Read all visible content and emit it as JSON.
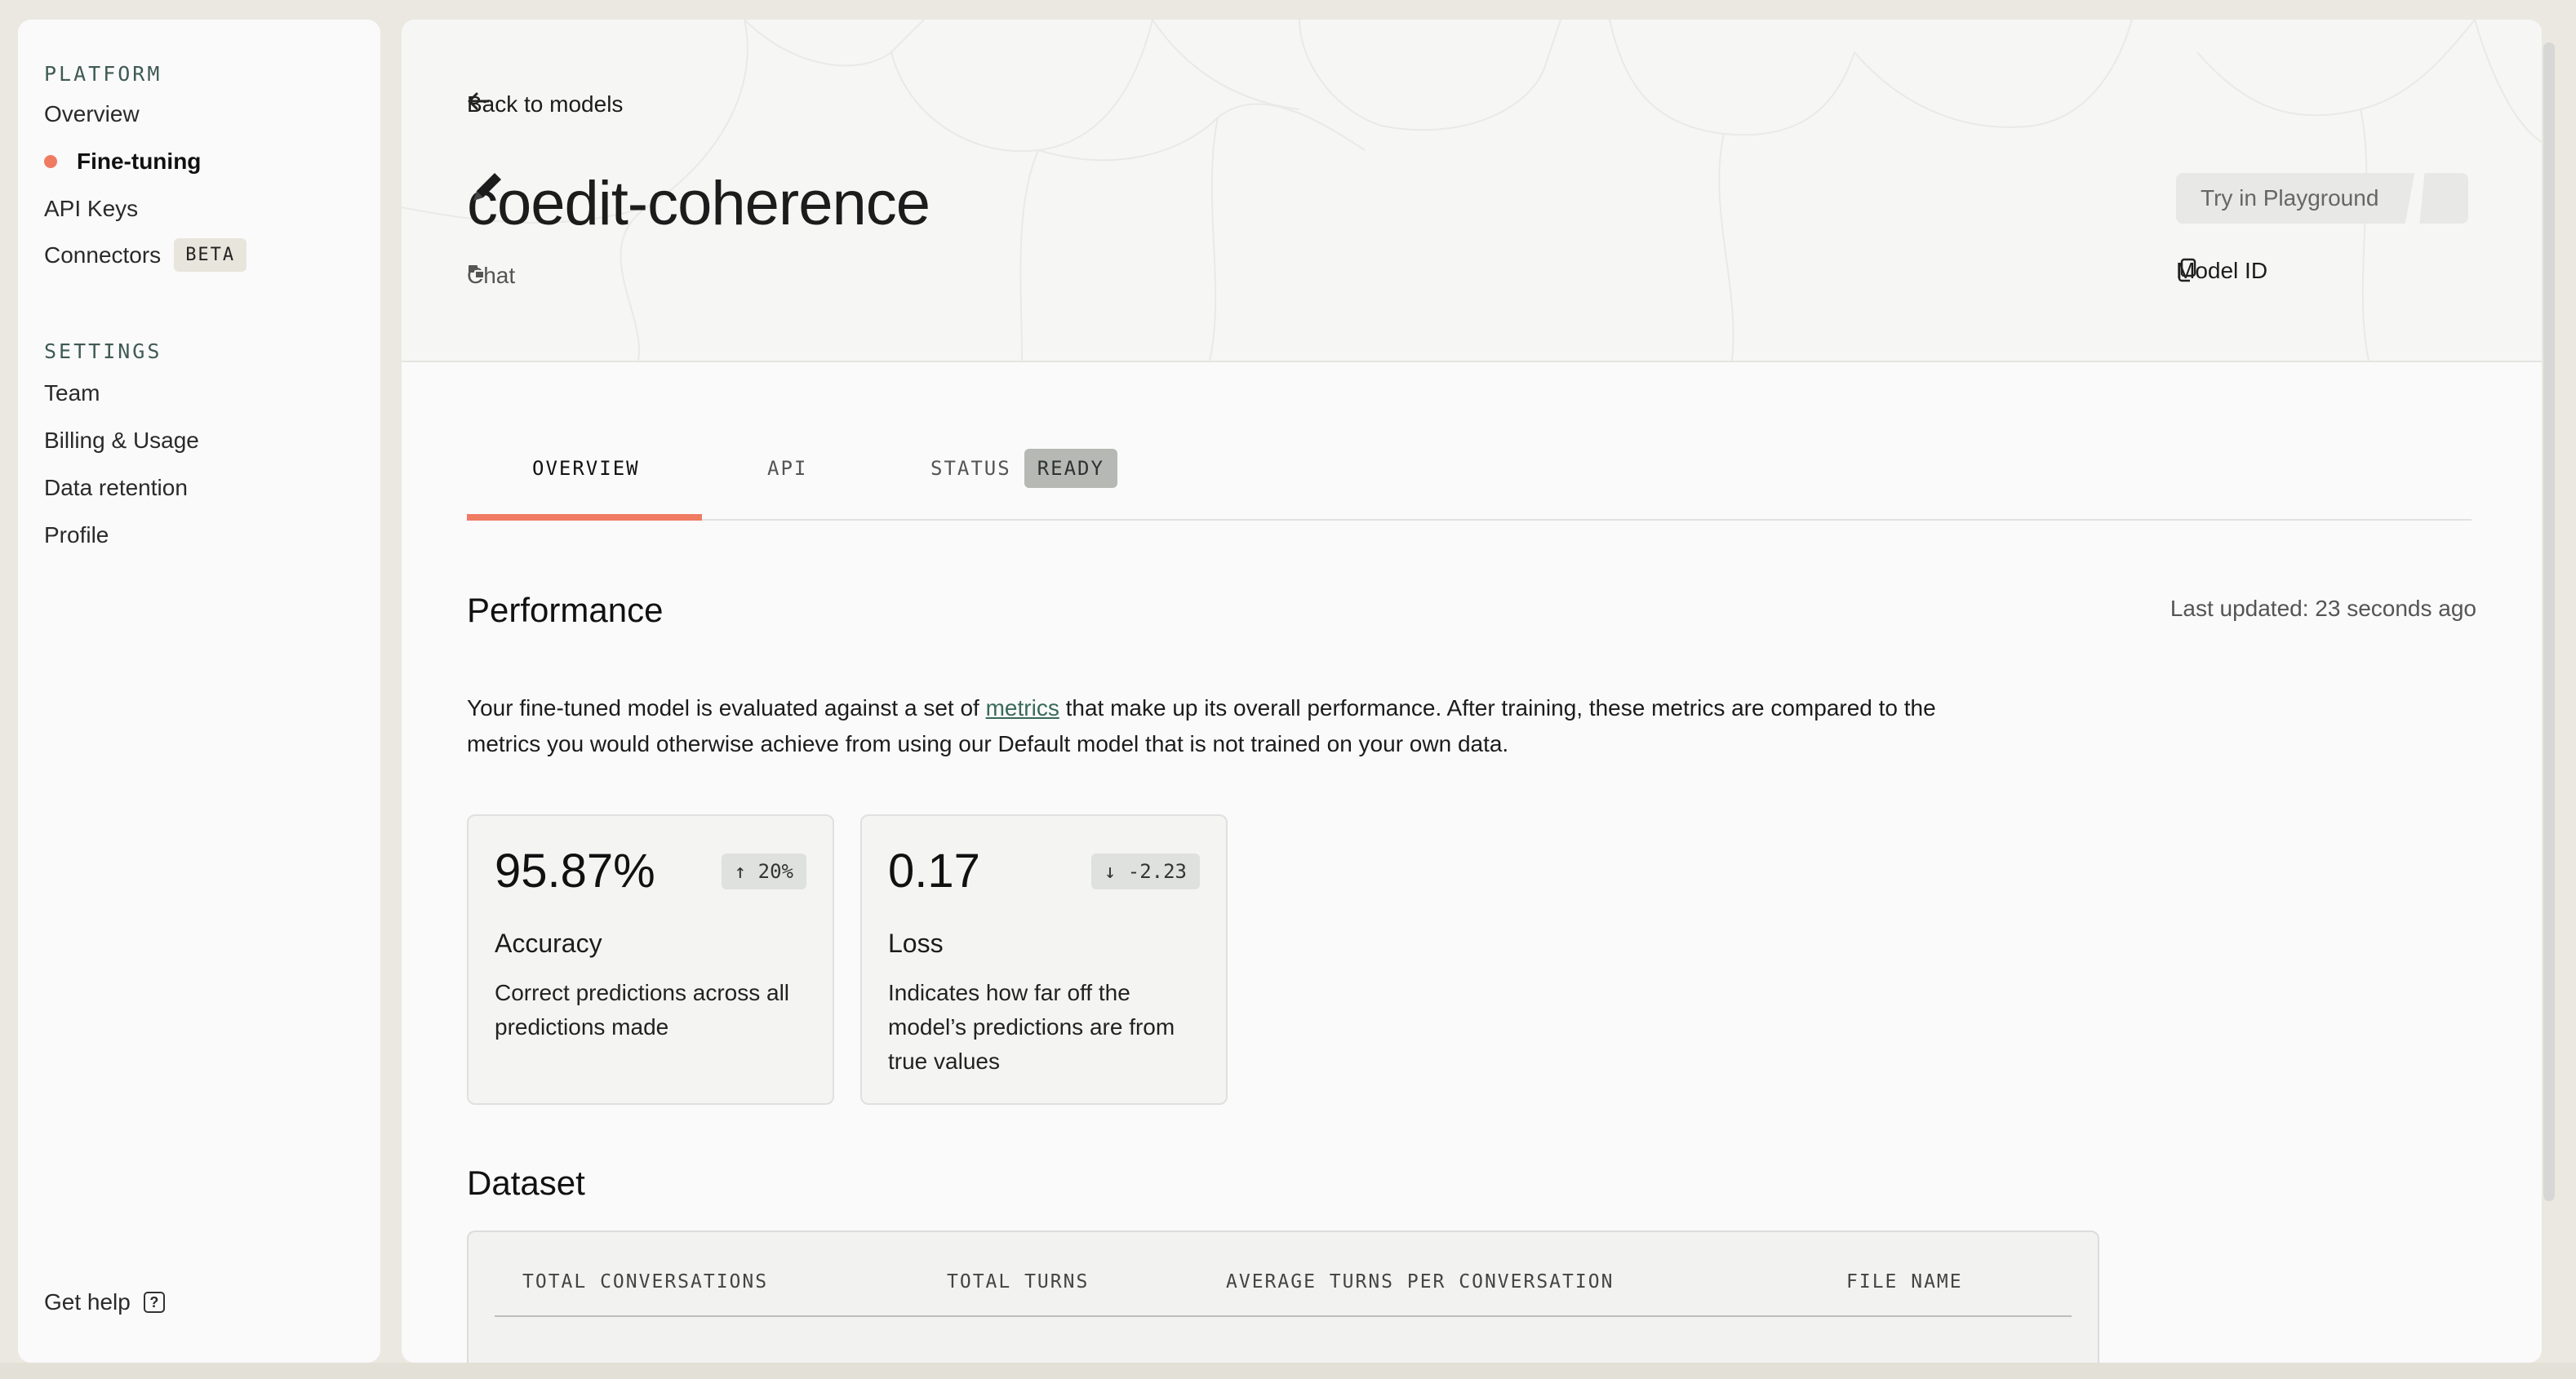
{
  "sidebar": {
    "platform_heading": "PLATFORM",
    "platform_items": [
      {
        "label": "Overview"
      },
      {
        "label": "Fine-tuning",
        "active": true
      },
      {
        "label": "API Keys"
      },
      {
        "label": "Connectors",
        "badge": "BETA"
      }
    ],
    "settings_heading": "SETTINGS",
    "settings_items": [
      {
        "label": "Team"
      },
      {
        "label": "Billing & Usage"
      },
      {
        "label": "Data retention"
      },
      {
        "label": "Profile"
      }
    ],
    "help_label": "Get help",
    "help_icon": "question-icon"
  },
  "header": {
    "back_label": "Back to models",
    "title": "coedit-coherence",
    "subtitle": "Chat",
    "playground_label": "Try in Playground",
    "model_id_label": "Model ID"
  },
  "tabs": {
    "overview": "OVERVIEW",
    "api": "API",
    "status": "STATUS",
    "status_value": "READY"
  },
  "performance": {
    "title": "Performance",
    "last_updated": "Last updated: 23 seconds ago",
    "desc_before": "Your fine-tuned model is evaluated against a set of ",
    "desc_link": "metrics",
    "desc_after": " that make up its overall performance. After training, these metrics are compared to the metrics you would otherwise achieve from using our Default model that is not trained on your own data.",
    "cards": [
      {
        "value": "95.87%",
        "delta": "20%",
        "delta_dir": "up",
        "label": "Accuracy",
        "desc": "Correct predictions across all predictions made"
      },
      {
        "value": "0.17",
        "delta": "-2.23",
        "delta_dir": "down",
        "label": "Loss",
        "desc": "Indicates how far off the model’s predictions are from true values"
      }
    ]
  },
  "dataset": {
    "title": "Dataset",
    "columns": [
      "TOTAL CONVERSATIONS",
      "TOTAL TURNS",
      "AVERAGE TURNS PER CONVERSATION",
      "FILE NAME"
    ]
  },
  "colors": {
    "accent": "#ef7b62",
    "ready_badge": "#b6b8b4",
    "link": "#3a6a59"
  }
}
